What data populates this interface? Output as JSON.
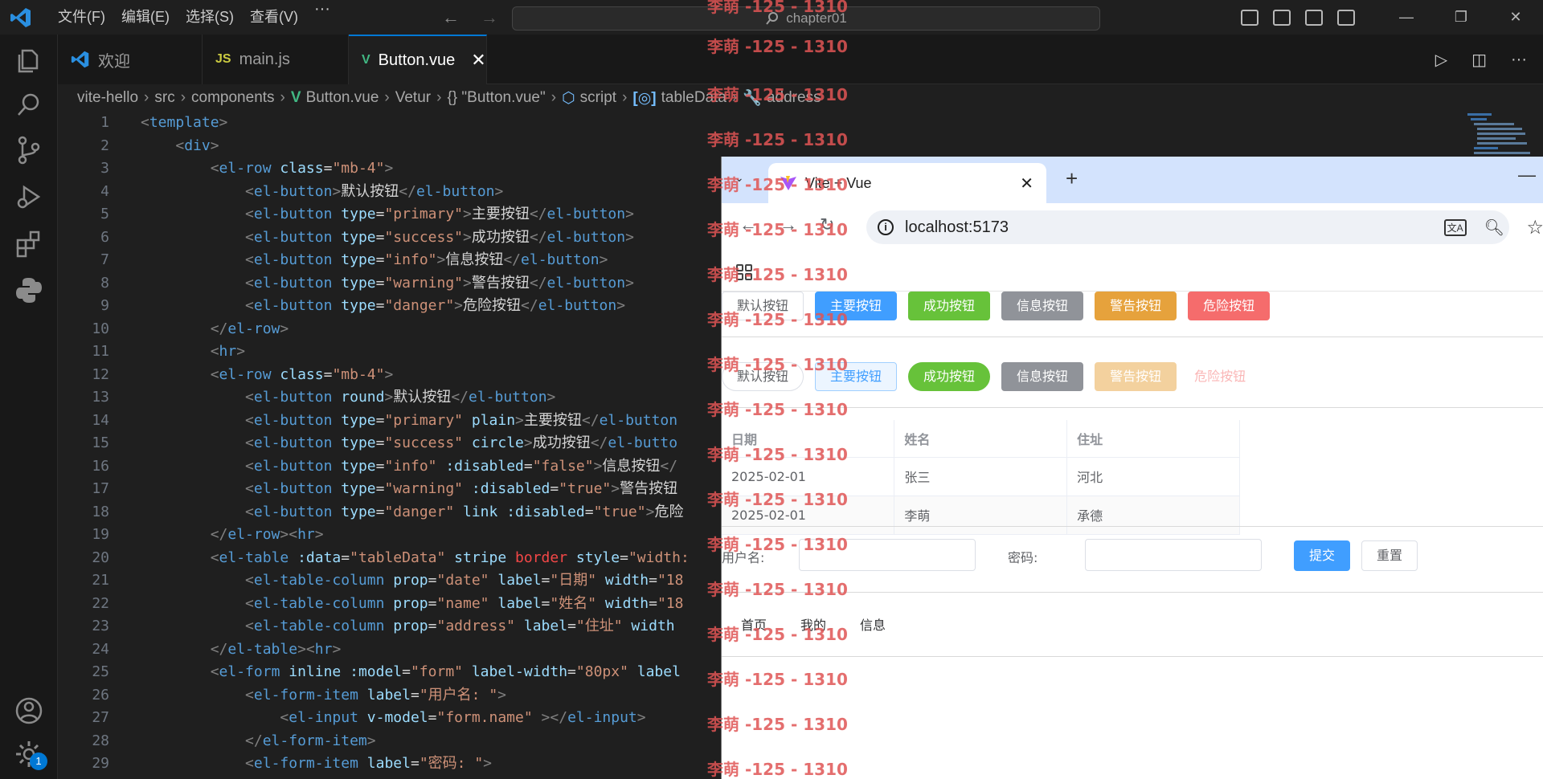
{
  "menu": {
    "file": "文件(F)",
    "edit": "编辑(E)",
    "selection": "选择(S)",
    "view": "查看(V)",
    "more": "···"
  },
  "search": {
    "text": "chapter01"
  },
  "tabs": [
    {
      "label": "欢迎",
      "icon": "vscode-icon"
    },
    {
      "label": "main.js",
      "icon": "JS"
    },
    {
      "label": "Button.vue",
      "icon": "V"
    }
  ],
  "breadcrumbs": [
    "vite-hello",
    "src",
    "components",
    "Button.vue",
    "Vetur",
    "{} \"Button.vue\"",
    "script",
    "tableData",
    "address"
  ],
  "badge": "1",
  "lines": [
    "1",
    "2",
    "3",
    "4",
    "5",
    "6",
    "7",
    "8",
    "9",
    "10",
    "11",
    "12",
    "13",
    "14",
    "15",
    "16",
    "17",
    "18",
    "19",
    "20",
    "21",
    "22",
    "23",
    "24",
    "25",
    "26",
    "27",
    "28",
    "29"
  ],
  "code": {
    "l1": {
      "a": "<",
      "b": "template",
      "c": ">"
    },
    "l2": {
      "a": "    <",
      "b": "div",
      "c": ">"
    },
    "l3": {
      "a": "        <",
      "b": "el-row",
      "c": " class",
      "d": "=",
      "e": "\"mb-4\"",
      "f": ">"
    },
    "l4": {
      "a": "            <",
      "b": "el-button",
      "c": ">",
      "d": "默认按钮",
      "e": "</",
      "f": "el-button",
      "g": ">"
    },
    "l5": {
      "a": "            <",
      "b": "el-button",
      "c": " type",
      "d": "=",
      "e": "\"primary\"",
      "f": ">",
      "g": "主要按钮",
      "h": "</",
      "i": "el-button",
      "j": ">"
    },
    "l6": {
      "a": "            <",
      "b": "el-button",
      "c": " type",
      "d": "=",
      "e": "\"success\"",
      "f": ">",
      "g": "成功按钮",
      "h": "</",
      "i": "el-button",
      "j": ">"
    },
    "l7": {
      "a": "            <",
      "b": "el-button",
      "c": " type",
      "d": "=",
      "e": "\"info\"",
      "f": ">",
      "g": "信息按钮",
      "h": "</",
      "i": "el-button",
      "j": ">"
    },
    "l8": {
      "a": "            <",
      "b": "el-button",
      "c": " type",
      "d": "=",
      "e": "\"warning\"",
      "f": ">",
      "g": "警告按钮",
      "h": "</",
      "i": "el-button",
      "j": ">"
    },
    "l9": {
      "a": "            <",
      "b": "el-button",
      "c": " type",
      "d": "=",
      "e": "\"danger\"",
      "f": ">",
      "g": "危险按钮",
      "h": "</",
      "i": "el-button",
      "j": ">"
    },
    "l10": {
      "a": "        </",
      "b": "el-row",
      "c": ">"
    },
    "l11": {
      "a": "        <",
      "b": "hr",
      "c": ">"
    },
    "l12": {
      "a": "        <",
      "b": "el-row",
      "c": " class",
      "d": "=",
      "e": "\"mb-4\"",
      "f": ">"
    },
    "l13": {
      "a": "            <",
      "b": "el-button",
      "c": " round",
      "d": ">",
      "e": "默认按钮",
      "f": "</",
      "g": "el-button",
      "h": ">"
    },
    "l14": {
      "a": "            <",
      "b": "el-button",
      "c": " type",
      "d": "=",
      "e": "\"primary\"",
      "f": " plain",
      "g": ">",
      "h": "主要按钮",
      "i": "</",
      "j": "el-button"
    },
    "l15": {
      "a": "            <",
      "b": "el-button",
      "c": " type",
      "d": "=",
      "e": "\"success\"",
      "f": " circle",
      "g": ">",
      "h": "成功按钮",
      "i": "</",
      "j": "el-butto"
    },
    "l16": {
      "a": "            <",
      "b": "el-button",
      "c": " type",
      "d": "=",
      "e": "\"info\"",
      "f": " :disabled",
      "g": "=",
      "h": "\"false\"",
      "i": ">",
      "j": "信息按钮",
      "k": "</"
    },
    "l17": {
      "a": "            <",
      "b": "el-button",
      "c": " type",
      "d": "=",
      "e": "\"warning\"",
      "f": " :disabled",
      "g": "=",
      "h": "\"true\"",
      "i": ">",
      "j": "警告按钮"
    },
    "l18": {
      "a": "            <",
      "b": "el-button",
      "c": " type",
      "d": "=",
      "e": "\"danger\"",
      "f": " link",
      "g": " :disabled",
      "h": "=",
      "i": "\"true\"",
      "j": ">",
      "k": "危险"
    },
    "l19": {
      "a": "        </",
      "b": "el-row",
      "c": "><",
      "d": "hr",
      "e": ">"
    },
    "l20": {
      "a": "        <",
      "b": "el-table",
      "c": " :data",
      "d": "=",
      "e": "\"tableData\"",
      "f": " stripe",
      "g": " border",
      "h": " style",
      "i": "=",
      "j": "\"width:"
    },
    "l21": {
      "a": "            <",
      "b": "el-table-column",
      "c": " prop",
      "d": "=",
      "e": "\"date\"",
      "f": " label",
      "g": "=",
      "h": "\"日期\"",
      "i": " width",
      "j": "=",
      "k": "\"18"
    },
    "l22": {
      "a": "            <",
      "b": "el-table-column",
      "c": " prop",
      "d": "=",
      "e": "\"name\"",
      "f": " label",
      "g": "=",
      "h": "\"姓名\"",
      "i": " width",
      "j": "=",
      "k": "\"18"
    },
    "l23": {
      "a": "            <",
      "b": "el-table-column",
      "c": " prop",
      "d": "=",
      "e": "\"address\"",
      "f": " label",
      "g": "=",
      "h": "\"住址\"",
      "i": " width"
    },
    "l24": {
      "a": "        </",
      "b": "el-table",
      "c": "><",
      "d": "hr",
      "e": ">"
    },
    "l25": {
      "a": "        <",
      "b": "el-form",
      "c": " inline",
      "d": " :model",
      "e": "=",
      "f": "\"form\"",
      "g": " label-width",
      "h": "=",
      "i": "\"80px\"",
      "j": " label"
    },
    "l26": {
      "a": "            <",
      "b": "el-form-item",
      "c": " label",
      "d": "=",
      "e": "\"用户名: \"",
      "f": ">"
    },
    "l27": {
      "a": "                <",
      "b": "el-input",
      "c": " v-model",
      "d": "=",
      "e": "\"form.name\"",
      "f": " ></",
      "g": "el-input",
      "h": ">"
    },
    "l28": {
      "a": "            </",
      "b": "el-form-item",
      "c": ">"
    },
    "l29": {
      "a": "            <",
      "b": "el-form-item",
      "c": " label",
      "d": "=",
      "e": "\"密码: \"",
      "f": ">"
    }
  },
  "browser": {
    "tab_title": "Vite + Vue",
    "new_tab": "+",
    "minimize": "—",
    "url": "localhost:5173",
    "row1": [
      "默认按钮",
      "主要按钮",
      "成功按钮",
      "信息按钮",
      "警告按钮",
      "危险按钮"
    ],
    "row2": [
      "默认按钮",
      "主要按钮",
      "成功按钮",
      "信息按钮",
      "警告按钮",
      "危险按钮"
    ],
    "table": {
      "headers": [
        "日期",
        "姓名",
        "住址"
      ],
      "rows": [
        [
          "2025-02-01",
          "张三",
          "河北"
        ],
        [
          "2025-02-01",
          "李萌",
          "承德"
        ]
      ]
    },
    "form": {
      "username_label": "用户名:",
      "password_label": "密码:",
      "submit": "提交",
      "reset": "重置"
    },
    "menu": [
      "首页",
      "我的",
      "信息"
    ]
  },
  "watermark": "李萌 -125 - 1310",
  "colors": {
    "accent": "#0078d4",
    "primary": "#409eff",
    "success": "#67c23a",
    "info": "#909399",
    "warning": "#e6a23c",
    "danger": "#f56c6c"
  }
}
